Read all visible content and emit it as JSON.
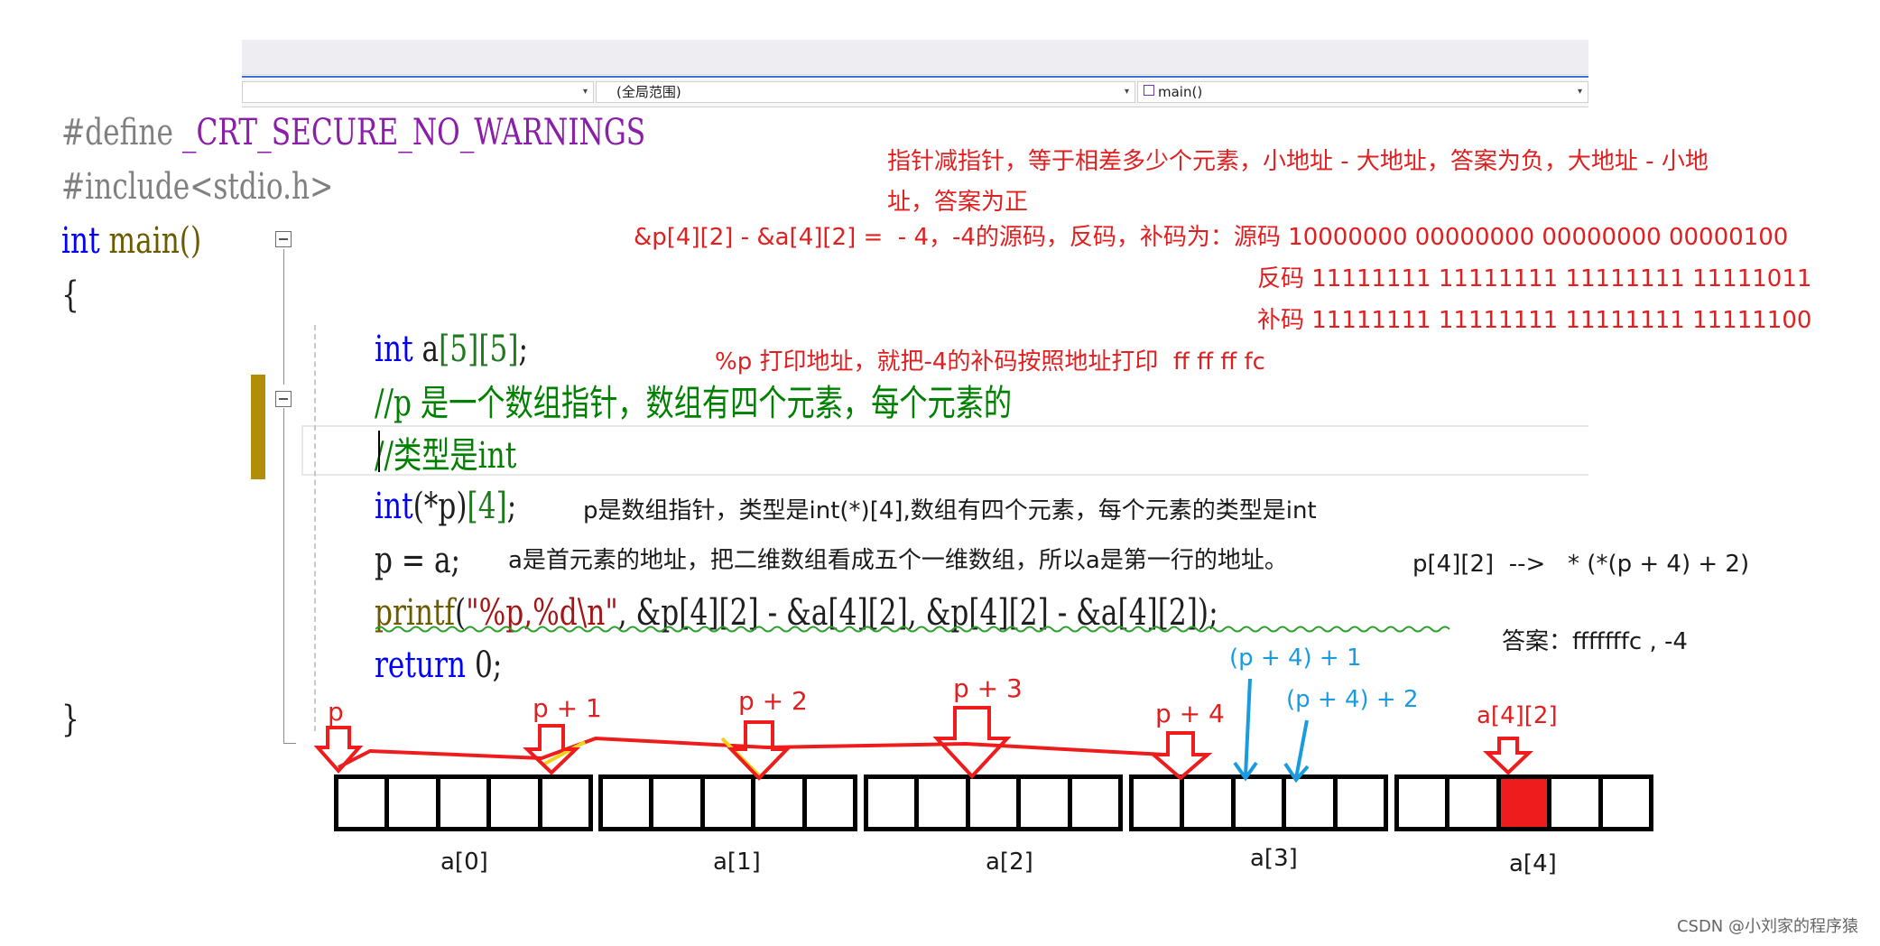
{
  "nav": {
    "left_arrow": "▾",
    "scope": "(全局范围)",
    "scope_arrow": "▾",
    "function": "main()",
    "function_arrow": "▾"
  },
  "code": {
    "l1_pp": "#define ",
    "l1_macro": "_CRT_SECURE_NO_WARNINGS",
    "l2_pp": "#include<stdio.h>",
    "l3_kw": "int",
    "l3_rest": " main()",
    "l4": "{",
    "l5_kw": "int",
    "l5_rest": " a",
    "l5_dims": "[5][5]",
    "l5_end": ";",
    "l6": "//p 是一个数组指针，数组有四个元素，每个元素的",
    "l7": "//类型是int",
    "l8_kw": "int",
    "l8_rest": "(*p)",
    "l8_dim": "[4]",
    "l8_end": ";",
    "l9": "p = a;",
    "l10_fn": "printf",
    "l10_open": "(",
    "l10_str": "\"%p,%d\\n\"",
    "l10_rest": ", &p[4][2] - &a[4][2], &p[4][2] - &a[4][2]);",
    "l11_kw": "return",
    "l11_rest": " 0;",
    "l12": "}"
  },
  "annotations": {
    "ptr_sub_1": "指针减指针，等于相差多少个元素，小地址 - 大地址，答案为负，大地址 - 小地",
    "ptr_sub_2": "址，答案为正",
    "diff_line": "&p[4][2] - &a[4][2] =  - 4，-4的源码，反码，补码为：源码 10000000 00000000 00000000 00000100",
    "one_comp": "反码 11111111 11111111 11111111 11111011",
    "two_comp": "补码 11111111 11111111 11111111 11111100",
    "percent_p": "%p 打印地址，就把-4的补码按照地址打印  ff ff ff fc",
    "p_type": "p是数组指针，类型是int(*)[4],数组有四个元素，每个元素的类型是int",
    "a_addr": "a是首元素的地址，把二维数组看成五个一维数组，所以a是第一行的地址。",
    "equiv": "p[4][2]  -->   * (*(p + 4) + 2)",
    "answer": "答案：fffffffc , -4",
    "p4_plus_1": "(p + 4) + 1",
    "p4_plus_2": "(p + 4) + 2",
    "a42": "a[4][2]"
  },
  "diagram": {
    "pointer_labels": [
      "p",
      "p + 1",
      "p + 2",
      "p + 3",
      "p + 4"
    ],
    "group_labels": [
      "a[0]",
      "a[1]",
      "a[2]",
      "a[3]",
      "a[4]"
    ],
    "highlight_color": "#ee1c1c"
  },
  "watermark": "CSDN @小刘家的程序猿"
}
